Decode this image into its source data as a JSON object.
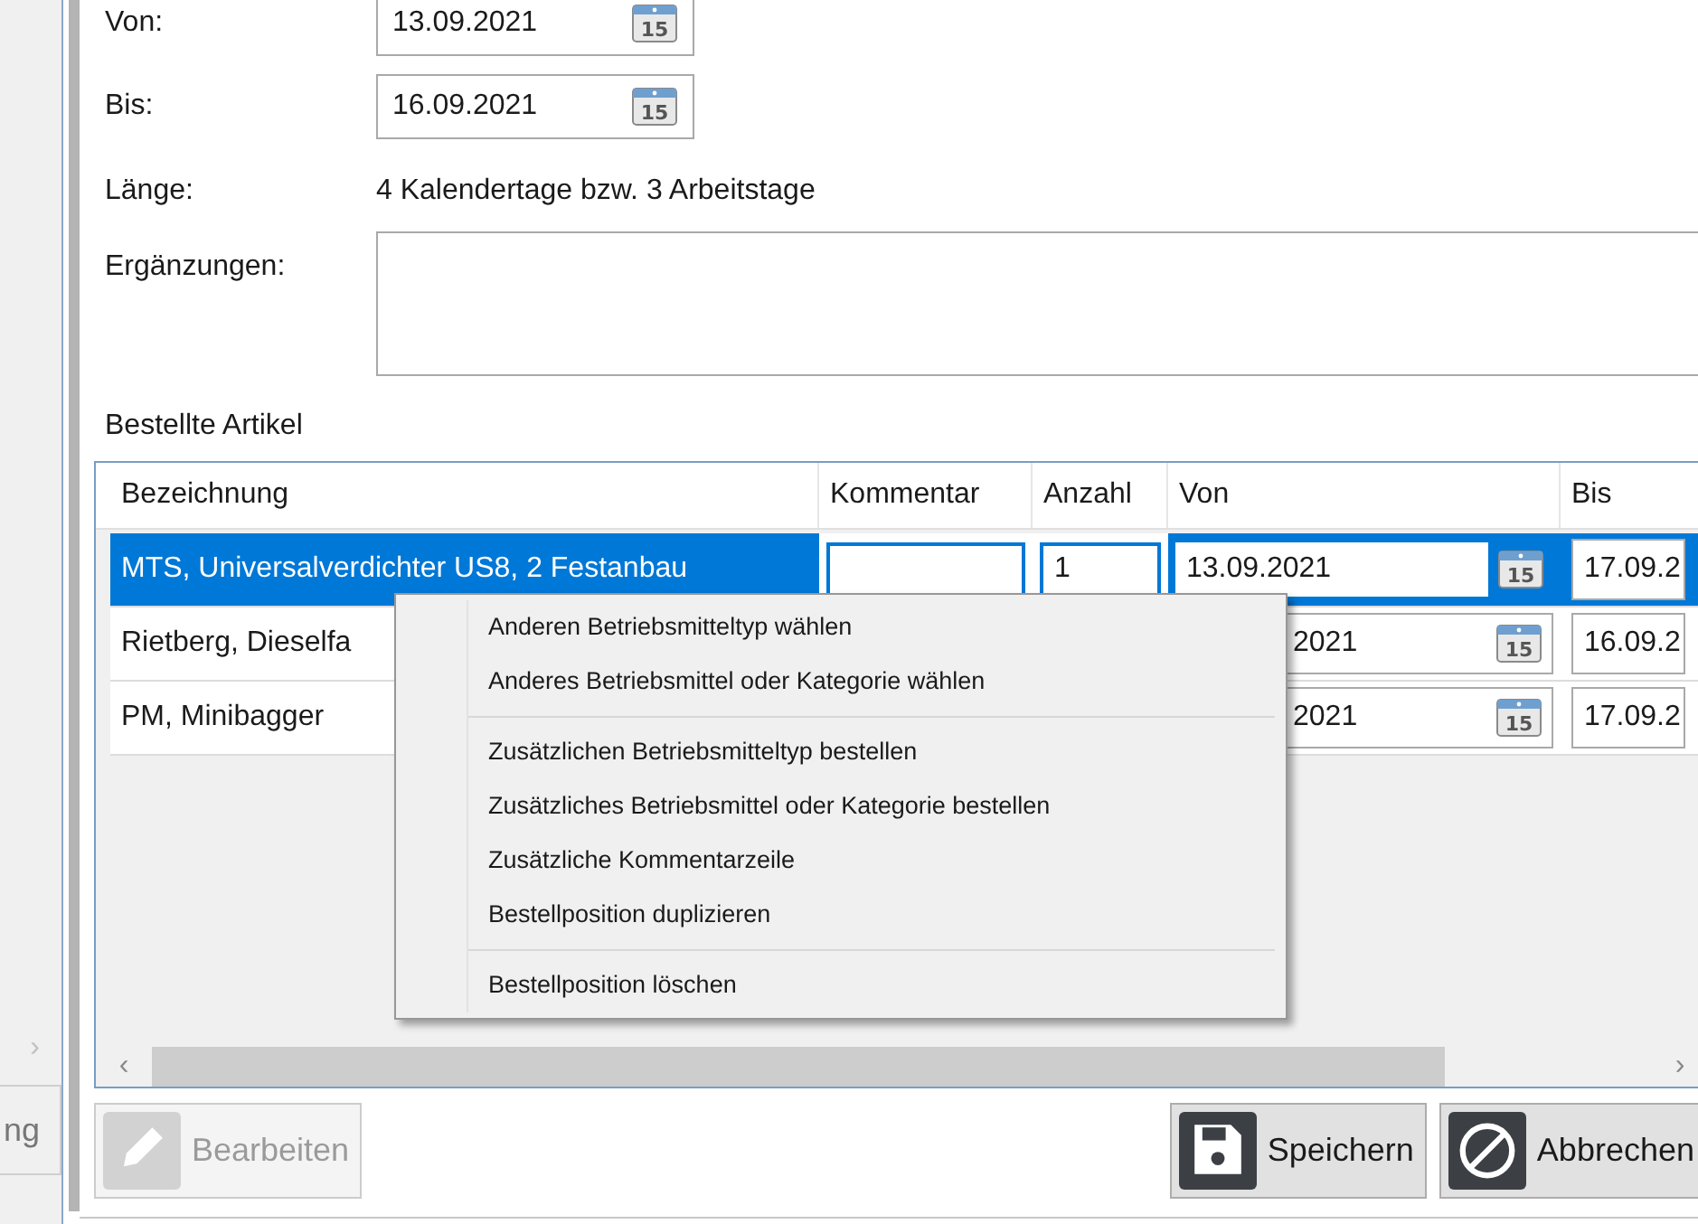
{
  "sidebar": {
    "button_fragment": "ng",
    "scroll_right": "›"
  },
  "form": {
    "fields": [
      {
        "label": "Von:",
        "value": "13.09.2021",
        "calendar_day": "15"
      },
      {
        "label": "Bis:",
        "value": "16.09.2021",
        "calendar_day": "15"
      }
    ],
    "length": {
      "label": "Länge:",
      "value": "4 Kalendertage bzw. 3 Arbeitstage"
    },
    "notes": {
      "label": "Ergänzungen:"
    }
  },
  "ordered_items": {
    "title": "Bestellte Artikel",
    "columns": [
      "Bezeichnung",
      "Kommentar",
      "Anzahl",
      "Von",
      "Bis"
    ],
    "rows": [
      {
        "name": "MTS, Universalverdichter US8, 2 Festanbau",
        "comment": "",
        "count": "1",
        "from": "13.09.2021",
        "calendar_day": "15",
        "to": "17.09.2",
        "selected": true
      },
      {
        "name": "Rietberg, Dieselfa",
        "from": "2021",
        "calendar_day": "15",
        "to": "16.09.2",
        "selected": false
      },
      {
        "name": "PM, Minibagger",
        "from": "2021",
        "calendar_day": "15",
        "to": "17.09.2",
        "selected": false
      }
    ],
    "scroll_left": "‹",
    "scroll_right": "›"
  },
  "context_menu": {
    "groups": [
      [
        "Anderen Betriebsmitteltyp wählen",
        "Anderes Betriebsmittel oder Kategorie wählen"
      ],
      [
        "Zusätzlichen Betriebsmitteltyp bestellen",
        "Zusätzliches Betriebsmittel oder Kategorie bestellen",
        "Zusätzliche Kommentarzeile",
        "Bestellposition duplizieren"
      ],
      [
        "Bestellposition löschen"
      ]
    ]
  },
  "buttons": [
    {
      "kind": "edit",
      "label": "Bearbeiten",
      "disabled": true
    },
    {
      "kind": "save",
      "label": "Speichern",
      "disabled": false
    },
    {
      "kind": "cancel",
      "label": "Abbrechen",
      "disabled": false
    }
  ]
}
